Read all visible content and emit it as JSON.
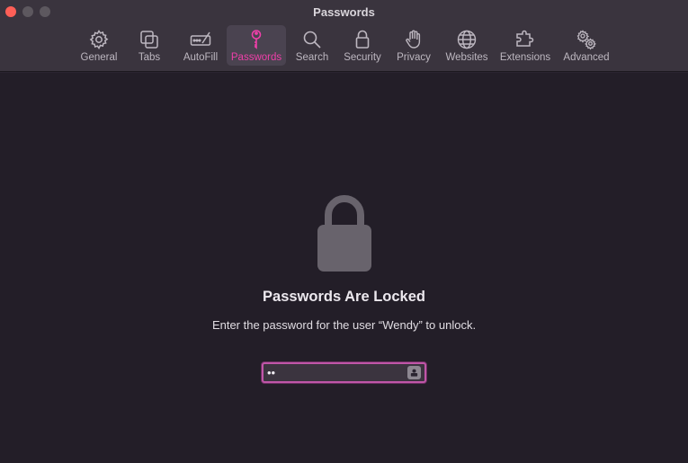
{
  "window": {
    "title": "Passwords"
  },
  "toolbar": {
    "items": [
      {
        "label": "General",
        "icon": "gear-icon"
      },
      {
        "label": "Tabs",
        "icon": "tabs-icon"
      },
      {
        "label": "AutoFill",
        "icon": "autofill-icon"
      },
      {
        "label": "Passwords",
        "icon": "key-icon",
        "active": true
      },
      {
        "label": "Search",
        "icon": "search-icon"
      },
      {
        "label": "Security",
        "icon": "lock-icon"
      },
      {
        "label": "Privacy",
        "icon": "hand-icon"
      },
      {
        "label": "Websites",
        "icon": "globe-icon"
      },
      {
        "label": "Extensions",
        "icon": "puzzle-icon"
      },
      {
        "label": "Advanced",
        "icon": "gears-icon"
      }
    ]
  },
  "main": {
    "heading": "Passwords Are Locked",
    "message": "Enter the password for the user “Wendy” to unlock.",
    "password_field": {
      "value": "••"
    }
  },
  "colors": {
    "accent": "#ef3fa9",
    "close": "#fe5f57",
    "field_border": "#c056a8"
  }
}
